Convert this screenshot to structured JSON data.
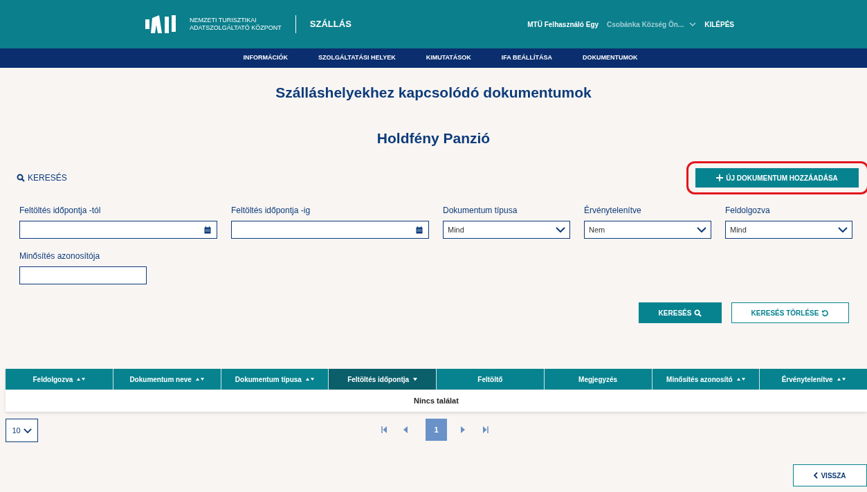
{
  "header": {
    "org_line_1": "NEMZETI TURISZTIKAI",
    "org_line_2": "ADATSZOLGÁLTATÓ KÖZPONT",
    "app_name": "SZÁLLÁS",
    "user": "MTÜ Felhasználó Egy",
    "organization": "Csobánka Község Ön...",
    "logout": "KILÉPÉS"
  },
  "nav": [
    {
      "label": "INFORMÁCIÓK",
      "selected": false
    },
    {
      "label": "SZOLGÁLTATÁSI HELYEK",
      "selected": false
    },
    {
      "label": "KIMUTATÁSOK",
      "selected": false
    },
    {
      "label": "IFA BEÁLLÍTÁSA",
      "selected": false
    },
    {
      "label": "DOKUMENTUMOK",
      "selected": false
    }
  ],
  "page_title": "Szálláshelyekhez kapcsolódó dokumentumok",
  "accommodation": "Holdfény Panzió",
  "search_toggle": "KERESÉS",
  "add_button": "ÚJ DOKUMENTUM HOZZÁADÁSA",
  "filters": [
    {
      "kind": "date",
      "label": "Feltöltés időpontja -tól"
    },
    {
      "kind": "date",
      "label": "Feltöltés időpontja -ig"
    },
    {
      "kind": "select",
      "label": "Dokumentum típusa",
      "value": "Mind"
    },
    {
      "kind": "select",
      "label": "Érvénytelenítve",
      "value": "Nem"
    },
    {
      "kind": "select",
      "label": "Feldolgozva",
      "value": "Mind"
    },
    {
      "kind": "text",
      "label": "Minősítés azonosítója"
    }
  ],
  "search_button": "KERESÉS",
  "clear_button": "KERESÉS TÖRLÉSE",
  "table": {
    "columns": [
      {
        "label": "Feldolgozva",
        "kind": "sortable",
        "selected": false
      },
      {
        "label": "Dokumentum neve",
        "kind": "sortable",
        "selected": false
      },
      {
        "label": "Dokumentum típusa",
        "kind": "sortable",
        "selected": false
      },
      {
        "label": "Feltöltés időpontja",
        "kind": "sorted",
        "selected": true
      },
      {
        "label": "Feltöltő",
        "kind": "plain",
        "selected": false
      },
      {
        "label": "Megjegyzés",
        "kind": "plain",
        "selected": false
      },
      {
        "label": "Minősítés azonosító",
        "kind": "sortable",
        "selected": false
      },
      {
        "label": "Érvénytelenítve",
        "kind": "sortable",
        "selected": false
      }
    ],
    "empty_message": "Nincs találat"
  },
  "page_size": "10",
  "pages": [
    {
      "label": "1",
      "selected": true
    }
  ],
  "back_button": "VISSZA"
}
